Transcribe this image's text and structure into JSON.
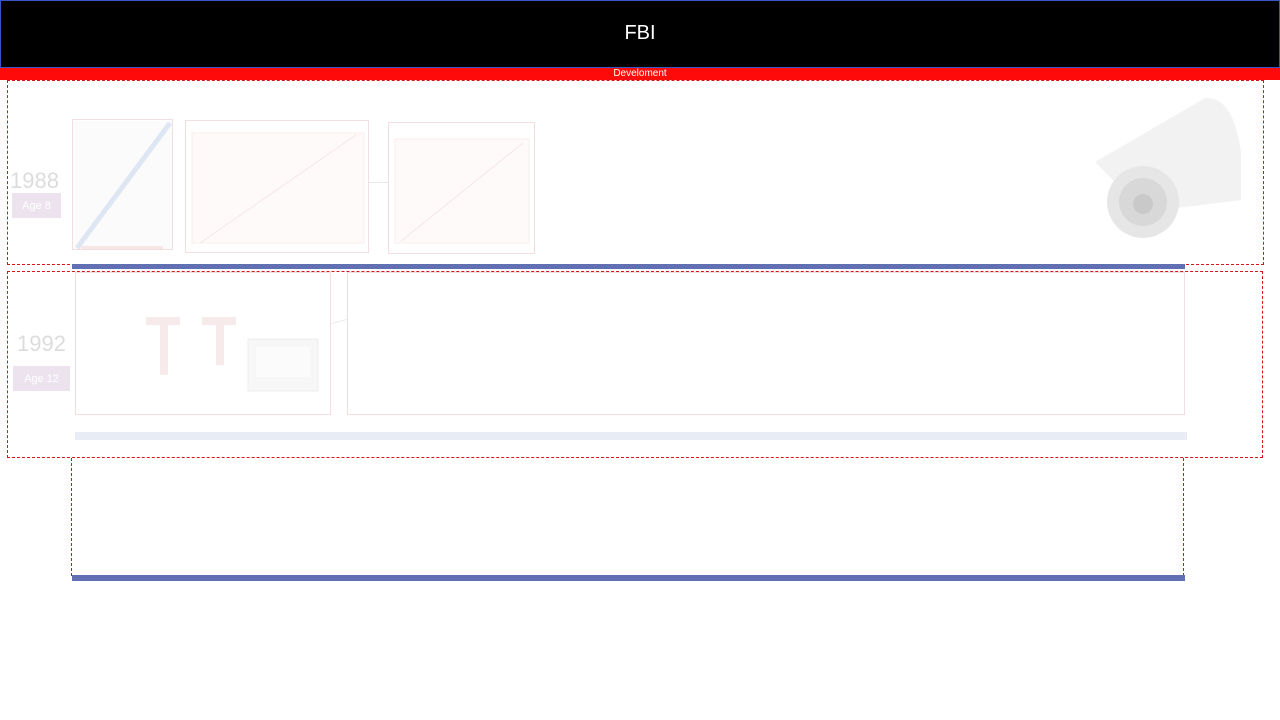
{
  "header": {
    "title": "FBI",
    "subtitle": "Develoment",
    "colors": {
      "bar": "#000000",
      "accent": "#ff0a0a",
      "outline": "#3a55c8"
    }
  },
  "timeline": [
    {
      "year": "1988",
      "age_label": "Age  8",
      "thumbnails": [
        "magazine-cover-icon",
        "document-photo-icon",
        "document-photo-icon"
      ],
      "decoration": "security-camera-icon"
    },
    {
      "year": "1992",
      "age_label": "Age  12",
      "thumbnails": [
        "equipment-photo-icon",
        "blank-panel"
      ]
    }
  ],
  "colors": {
    "dashed_border": "#d6151b",
    "band_primary": "#6170b3",
    "band_light": "#e8ecf5",
    "age_badge": "#ece3ee"
  }
}
